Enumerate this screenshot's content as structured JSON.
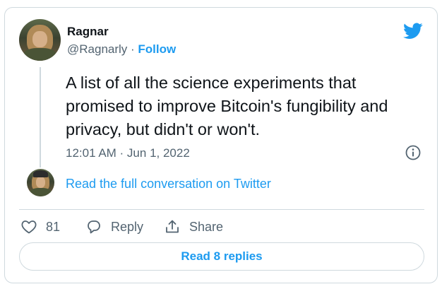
{
  "author": {
    "display_name": "Ragnar",
    "handle": "@Ragnarly",
    "separator": " · ",
    "follow_label": "Follow"
  },
  "tweet": {
    "text": "A list of all the science experiments that promised to improve Bitcoin's fungibility and privacy, but didn't or won't.",
    "timestamp": "12:01 AM · Jun 1, 2022"
  },
  "conversation_link": "Read the full conversation on Twitter",
  "actions": {
    "like_count": "81",
    "reply_label": "Reply",
    "share_label": "Share"
  },
  "read_replies_label": "Read 8 replies",
  "colors": {
    "accent": "#1d9bf0",
    "text_primary": "#0f1419",
    "text_secondary": "#536471",
    "border": "#cfd9de"
  },
  "icons": [
    "twitter-bird-icon",
    "info-icon",
    "heart-icon",
    "reply-bubble-icon",
    "share-icon"
  ]
}
